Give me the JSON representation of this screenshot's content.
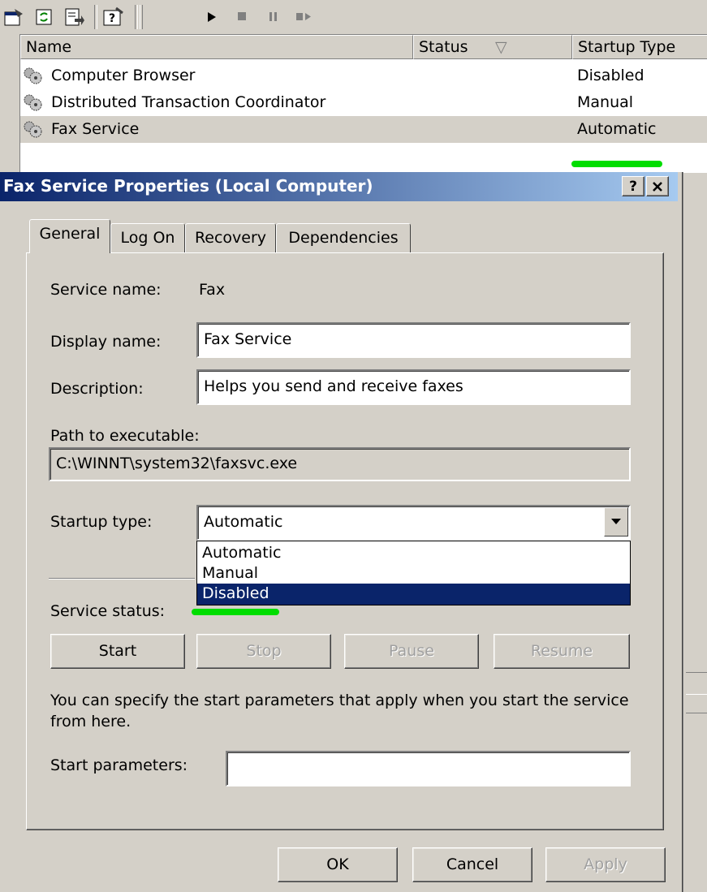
{
  "toolbar": {
    "icons": [
      "properties-icon",
      "refresh-icon",
      "export-list-icon",
      "help-icon",
      "start-service-icon",
      "stop-service-icon",
      "pause-service-icon",
      "restart-service-icon"
    ]
  },
  "list": {
    "columns": [
      "Name",
      "Status",
      "Startup Type"
    ],
    "rows": [
      {
        "name": "Computer Browser",
        "status": "",
        "startup": "Disabled"
      },
      {
        "name": "Distributed Transaction Coordinator",
        "status": "",
        "startup": "Manual"
      },
      {
        "name": "Fax Service",
        "status": "",
        "startup": "Automatic"
      }
    ],
    "sort_indicator": "▽"
  },
  "dialog": {
    "title": "Fax Service Properties (Local Computer)",
    "help_btn": "?",
    "close_btn": "✕",
    "tabs": [
      "General",
      "Log On",
      "Recovery",
      "Dependencies"
    ],
    "active_tab": "General",
    "service_name_label": "Service name:",
    "service_name": "Fax",
    "display_name_label": "Display name:",
    "display_name": "Fax Service",
    "description_label": "Description:",
    "description": "Helps you send and receive faxes",
    "path_label": "Path to executable:",
    "path": "C:\\WINNT\\system32\\faxsvc.exe",
    "startup_type_label": "Startup type:",
    "startup_type": "Automatic",
    "startup_options": [
      "Automatic",
      "Manual",
      "Disabled"
    ],
    "startup_highlighted": "Disabled",
    "service_status_label": "Service status:",
    "service_buttons": {
      "start": "Start",
      "stop": "Stop",
      "pause": "Pause",
      "resume": "Resume"
    },
    "hint": "You can specify the start parameters that apply when you start the service from here.",
    "start_params_label": "Start parameters:",
    "start_params": "",
    "ok": "OK",
    "cancel": "Cancel",
    "apply": "Apply"
  },
  "colors": {
    "titlebar_start": "#0a246a",
    "titlebar_end": "#a6caf0",
    "selection": "#0a246a",
    "annotation": "#00dd00"
  }
}
